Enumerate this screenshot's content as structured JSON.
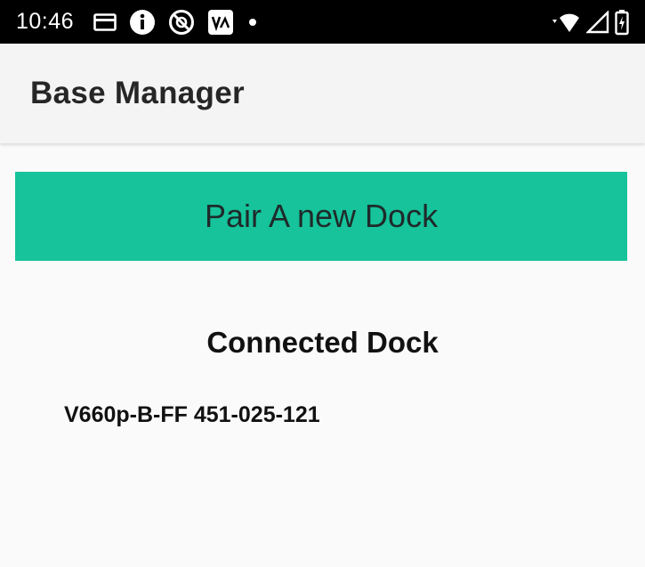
{
  "status_bar": {
    "time": "10:46",
    "left_icons": [
      "card-icon",
      "info-icon",
      "no-disturb-icon",
      "app-badge-icon",
      "dot-icon"
    ],
    "right_icons": [
      "wifi-icon",
      "signal-icon",
      "battery-icon"
    ]
  },
  "app_bar": {
    "title": "Base Manager"
  },
  "main": {
    "pair_button_label": "Pair A new Dock",
    "section_title": "Connected Dock",
    "docks": [
      "V660p-B-FF 451-025-121"
    ]
  },
  "colors": {
    "accent": "#16c39b",
    "status_bar": "#000000",
    "app_bar": "#f4f4f4",
    "background": "#fafafa"
  }
}
